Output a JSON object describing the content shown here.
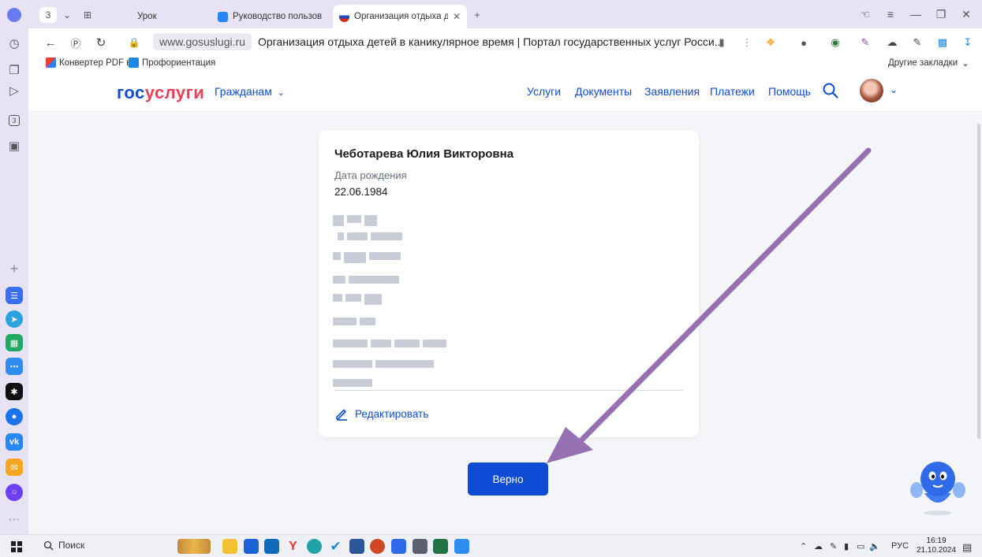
{
  "browser": {
    "tab_counter": "3",
    "tabs": [
      {
        "label": "Урок",
        "favicon_color": ""
      },
      {
        "label": "Руководство пользовате",
        "favicon_color": "#2787f5"
      },
      {
        "label": "Организация отдыха д",
        "favicon_color": "#1b4cbe",
        "active": true
      }
    ],
    "url_domain": "www.gosuslugi.ru",
    "page_title": "Организация отдыха детей в каникулярное время | Портал государственных услуг Росси...",
    "bookmarks": [
      {
        "label": "Конвертер PDF в",
        "icon_color": "#e8412b"
      },
      {
        "label": "Профориентация",
        "icon_color": "#1e88e5"
      }
    ],
    "other_bookmarks": "Другие закладки"
  },
  "site": {
    "logo_part1": "гос",
    "logo_part2": "услуги",
    "citizens_menu": "Гражданам",
    "nav": [
      "Услуги",
      "Документы",
      "Заявления",
      "Платежи",
      "Помощь"
    ],
    "brand_color": "#0d4cd3",
    "accent_red": "#ee3f58"
  },
  "card": {
    "full_name": "Чеботарева Юлия Викторовна",
    "dob_label": "Дата рождения",
    "dob_value": "22.06.1984",
    "edit_link": "Редактировать"
  },
  "confirm_button": "Верно",
  "taskbar": {
    "search_label": "Поиск",
    "language": "РУС",
    "time": "16:19",
    "date": "21.10.2024"
  },
  "icons": [
    "search-icon",
    "chevron-down-icon",
    "pencil-icon",
    "avatar",
    "robot-assistant-icon",
    "arrow-annotation"
  ]
}
